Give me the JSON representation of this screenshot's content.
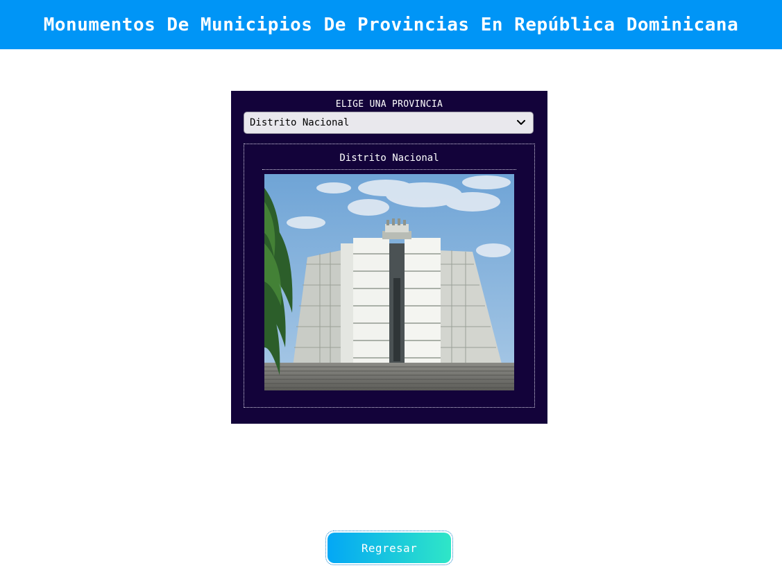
{
  "header": {
    "title": "Monumentos De Municipios De Provincias En República Dominicana"
  },
  "selector": {
    "label": "ELIGE UNA PROVINCIA",
    "selected": "Distrito Nacional",
    "icon": "chevron-down-icon"
  },
  "card": {
    "title": "Distrito Nacional",
    "image_subject": "monument-photo"
  },
  "back_button": {
    "label": "Regresar"
  },
  "colors": {
    "header_bg": "#0095f6",
    "panel_bg": "#13033a",
    "button_gradient_start": "#03a7f5",
    "button_gradient_end": "#2fe6c7"
  }
}
